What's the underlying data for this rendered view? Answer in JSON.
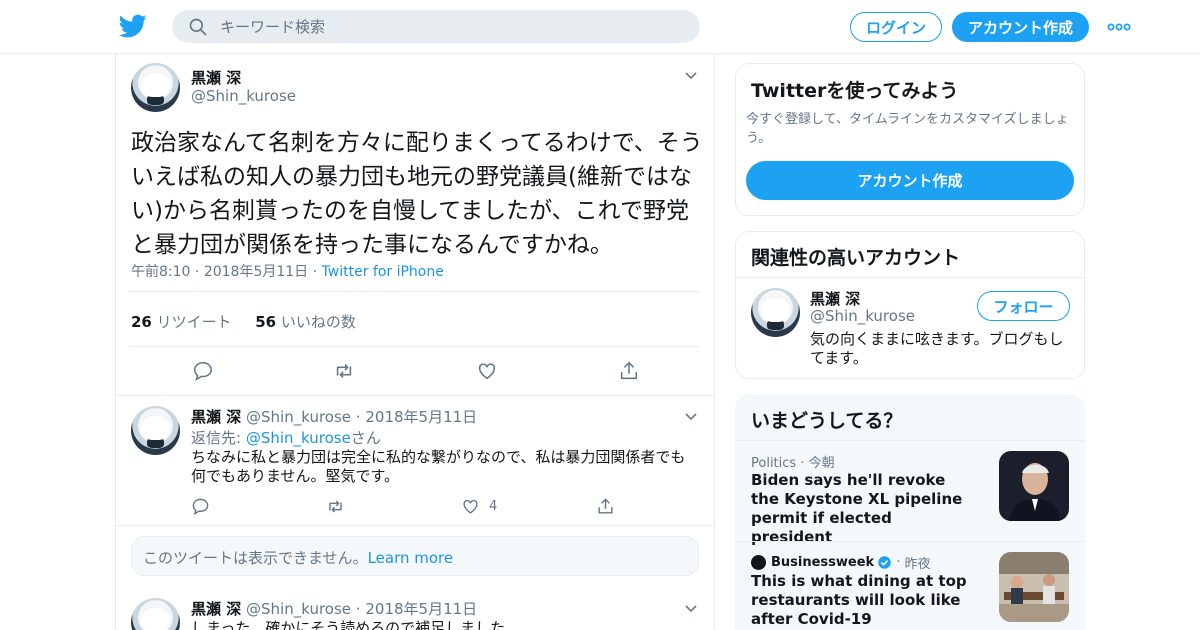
{
  "header": {
    "search_placeholder": "キーワード検索",
    "login_label": "ログイン",
    "signup_label": "アカウント作成"
  },
  "main_tweet": {
    "name": "黒瀬 深",
    "handle": "@Shin_kurose",
    "text": "政治家なんて名刺を方々に配りまくってるわけで、そういえば私の知人の暴力団も地元の野党議員(維新ではない)から名刺貰ったのを自慢してましたが、これで野党と暴力団が関係を持った事になるんですかね。",
    "time": "午前8:10",
    "date": "2018年5月11日",
    "source": "Twitter for iPhone",
    "retweets": "26",
    "retweets_label": "リツイート",
    "likes": "56",
    "likes_label": "いいねの数"
  },
  "replies": [
    {
      "name": "黒瀬 深",
      "handle": "@Shin_kurose",
      "date": "2018年5月11日",
      "reply_to_prefix": "返信先:",
      "reply_to_handle": "@Shin_kurose",
      "reply_to_suffix": "さん",
      "text": "ちなみに私と暴力団は完全に私的な繋がりなので、私は暴力団関係者でも何でもありません。堅気です。",
      "like_count": "4"
    },
    {
      "name": "黒瀬 深",
      "handle": "@Shin_kurose",
      "date": "2018年5月11日",
      "text": "しまった、確かにそう読めるので補足しました"
    }
  ],
  "unavailable": {
    "text": "このツイートは表示できません。",
    "link": "Learn more"
  },
  "signup_card": {
    "title": "Twitterを使ってみよう",
    "subtitle": "今すぐ登録して、タイムラインをカスタマイズしましょう。",
    "button": "アカウント作成"
  },
  "relevant_card": {
    "title": "関連性の高いアカウント",
    "name": "黒瀬 深",
    "handle": "@Shin_kurose",
    "follow_label": "フォロー",
    "bio": "気の向くままに呟きます。ブログもしてます。"
  },
  "trends_card": {
    "title": "いまどうしてる？",
    "items": [
      {
        "category": "Politics",
        "time": "今朝",
        "headline": "Biden says he'll revoke the Keystone XL pipeline permit if elected president"
      },
      {
        "category": "Businessweek",
        "time": "昨夜",
        "headline": "This is what dining at top restaurants will look like after Covid-19"
      }
    ]
  },
  "colors": {
    "accent": "#1da1f2",
    "text_secondary": "#657786",
    "border": "#e6ecf0",
    "link": "#1b95e0"
  },
  "icons": [
    "twitter-bird-icon",
    "search-icon",
    "more-dots-icon",
    "chevron-down-icon",
    "reply-icon",
    "retweet-icon",
    "like-icon",
    "share-icon",
    "verified-badge-icon"
  ]
}
